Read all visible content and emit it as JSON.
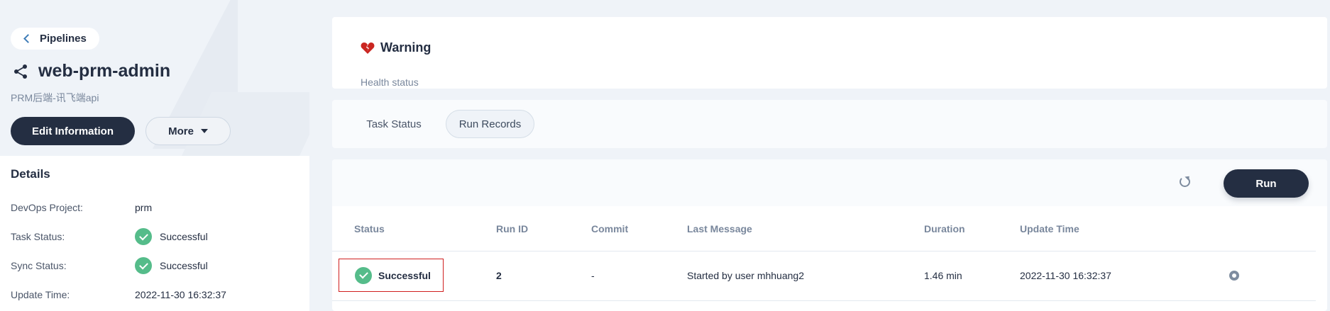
{
  "sidebar": {
    "back_label": "Pipelines",
    "title": "web-prm-admin",
    "subtitle": "PRM后端-讯飞端api",
    "edit_label": "Edit Information",
    "more_label": "More",
    "details_heading": "Details",
    "details": [
      {
        "key": "DevOps Project:",
        "value": "prm"
      },
      {
        "key": "Task Status:",
        "value": "Successful"
      },
      {
        "key": "Sync Status:",
        "value": "Successful"
      },
      {
        "key": "Update Time:",
        "value": "2022-11-30 16:32:37"
      }
    ]
  },
  "health": {
    "title": "Warning",
    "label": "Health status",
    "icon": "broken-heart-icon"
  },
  "tabs": [
    {
      "label": "Task Status"
    },
    {
      "label": "Run Records"
    }
  ],
  "runs": {
    "run_button": "Run",
    "columns": [
      "Status",
      "Run ID",
      "Commit",
      "Last Message",
      "Duration",
      "Update Time"
    ],
    "rows": [
      {
        "status": "Successful",
        "run_id": "2",
        "commit": "-",
        "message": "Started by user mhhuang2",
        "duration": "1.46 min",
        "update_time": "2022-11-30 16:32:37"
      }
    ]
  },
  "colors": {
    "primary": "#242e42",
    "success": "#55bc8a",
    "highlight": "#d01f1f",
    "warning_heart": "#ca2621"
  }
}
